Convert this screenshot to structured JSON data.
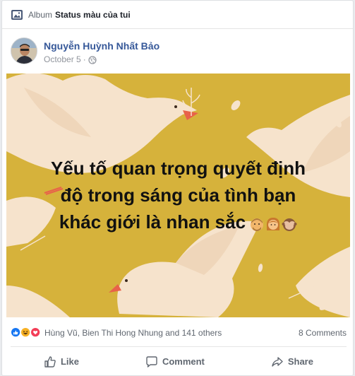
{
  "album": {
    "prefix": "Album",
    "name": "Status màu của tui"
  },
  "post": {
    "author": "Nguyễn Huỳnh Nhất Bảo",
    "date": "October 5",
    "separator": "·",
    "privacy_icon": "globe-icon",
    "status_lines": [
      "Yếu tố quan trọng quyết định",
      "độ trong sáng của tình bạn",
      "khác giới là nhan sắc"
    ],
    "status_emojis": [
      "man-emoji",
      "woman-emoji",
      "see-no-evil-monkey-emoji"
    ],
    "background_color": "#d6b23b"
  },
  "reactions": {
    "icons": [
      "like-icon",
      "haha-icon",
      "love-icon"
    ],
    "names": "Hùng Vũ, Bien Thi Hong Nhung and 141 others",
    "comments": "8 Comments"
  },
  "actions": {
    "like": "Like",
    "comment": "Comment",
    "share": "Share"
  },
  "colors": {
    "link": "#365899",
    "meta": "#90949c",
    "like_blue": "#1877f2",
    "love_red": "#f33e58",
    "haha_yellow": "#f7b125"
  }
}
